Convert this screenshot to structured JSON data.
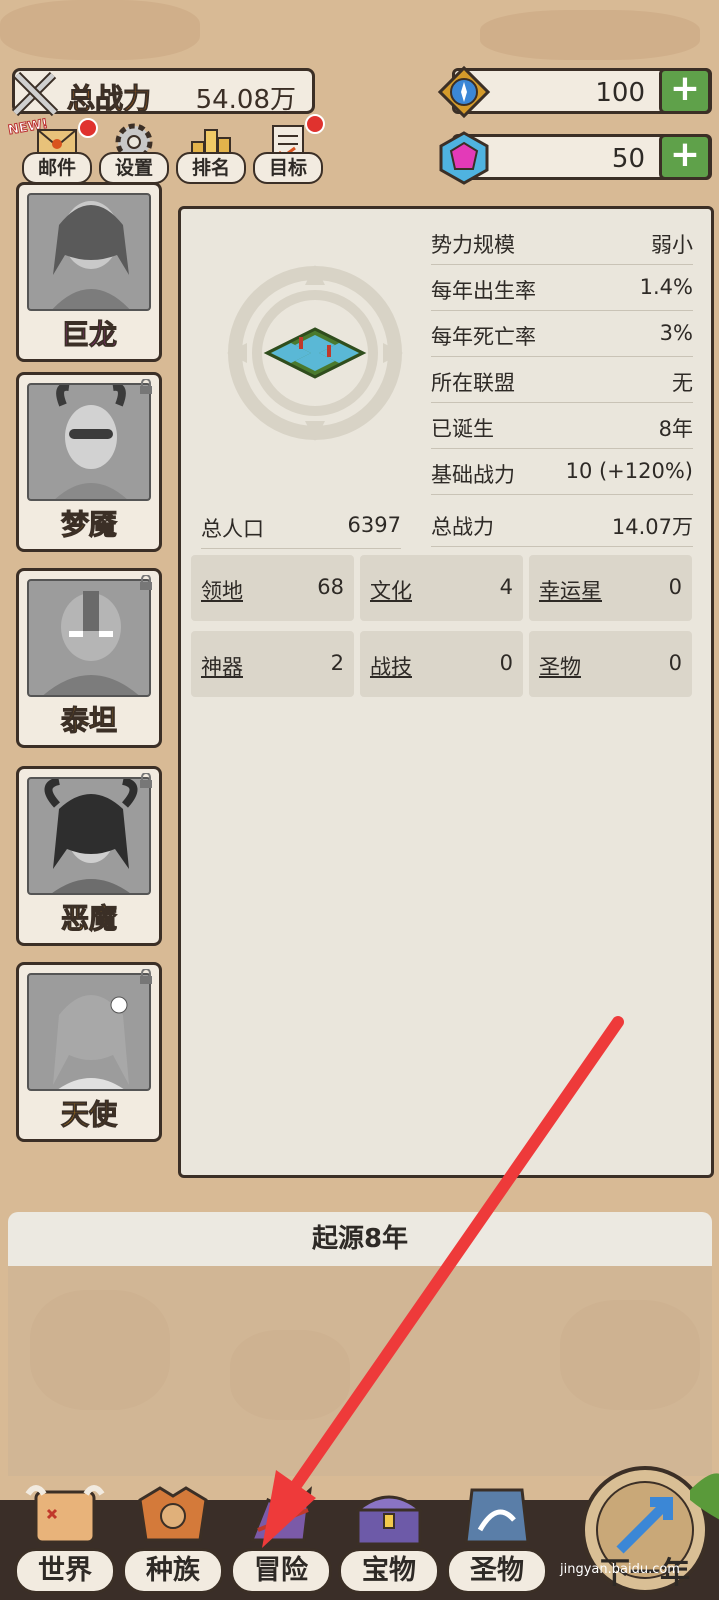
{
  "hud": {
    "power_label": "总战力",
    "power_value": "54.08万",
    "gems_value": "100",
    "crystals_value": "50",
    "plus_symbol": "+"
  },
  "menu": [
    {
      "label": "邮件",
      "icon": "mail-icon",
      "badge": true
    },
    {
      "label": "设置",
      "icon": "gear-icon",
      "badge": false
    },
    {
      "label": "排名",
      "icon": "ranking-icon",
      "badge": false
    },
    {
      "label": "目标",
      "icon": "goal-icon",
      "badge": true
    }
  ],
  "new_badge": "NEW!",
  "races": [
    {
      "name": "巨龙",
      "color": "#e12bd6",
      "locked": false
    },
    {
      "name": "梦魇",
      "color": "#f2a316",
      "locked": true
    },
    {
      "name": "泰坦",
      "color": "#f2a316",
      "locked": true
    },
    {
      "name": "恶魔",
      "color": "#f2a316",
      "locked": true
    },
    {
      "name": "天使",
      "color": "#f2a316",
      "locked": true
    }
  ],
  "stats": [
    {
      "k": "势力规模",
      "v": "弱小"
    },
    {
      "k": "每年出生率",
      "v": "1.4%"
    },
    {
      "k": "每年死亡率",
      "v": "3%"
    },
    {
      "k": "所在联盟",
      "v": "无"
    },
    {
      "k": "已诞生",
      "v": "8年"
    },
    {
      "k": "基础战力",
      "v": "10 (+120%)"
    },
    {
      "k": "总战力",
      "v": "14.07万"
    }
  ],
  "population": {
    "k": "总人口",
    "v": "6397"
  },
  "grid": [
    {
      "k": "领地",
      "v": "68"
    },
    {
      "k": "文化",
      "v": "4"
    },
    {
      "k": "幸运星",
      "v": "0"
    },
    {
      "k": "神器",
      "v": "2"
    },
    {
      "k": "战技",
      "v": "0"
    },
    {
      "k": "圣物",
      "v": "0"
    }
  ],
  "era_title": "起源8年",
  "nav": [
    {
      "label": "世界",
      "icon": "world-map-icon"
    },
    {
      "label": "种族",
      "icon": "tribe-icon"
    },
    {
      "label": "冒险",
      "icon": "adventure-icon"
    },
    {
      "label": "宝物",
      "icon": "treasure-chest-icon"
    },
    {
      "label": "圣物",
      "icon": "relic-icon"
    }
  ],
  "next_label": "下一年",
  "watermark": "jingyan.baidu.com",
  "colors": {
    "accent_orange": "#e57a12",
    "plus_green": "#5fa14a",
    "badge_red": "#e0322e",
    "annotation_arrow": "#ee3a3a"
  }
}
